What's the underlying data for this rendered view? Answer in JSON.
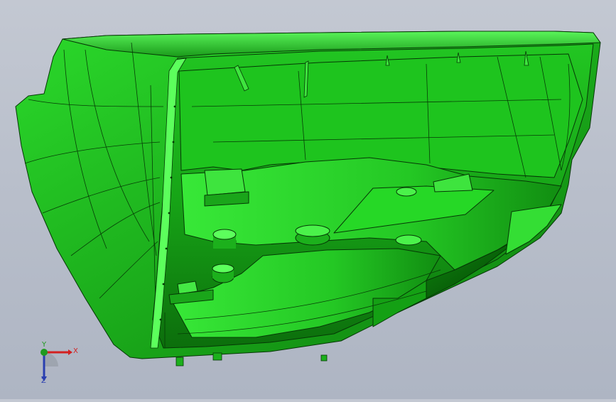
{
  "viewport": {
    "background_top": "#c3c8d2",
    "background_bottom": "#aeb5c3",
    "model_color": "#1db51d",
    "edge_color": "#063806"
  },
  "triad": {
    "x_label": "X",
    "y_label": "Y",
    "z_label": "Z",
    "x_color": "#d32020",
    "y_color": "#1f9a1f",
    "z_color": "#2a3fb0"
  }
}
